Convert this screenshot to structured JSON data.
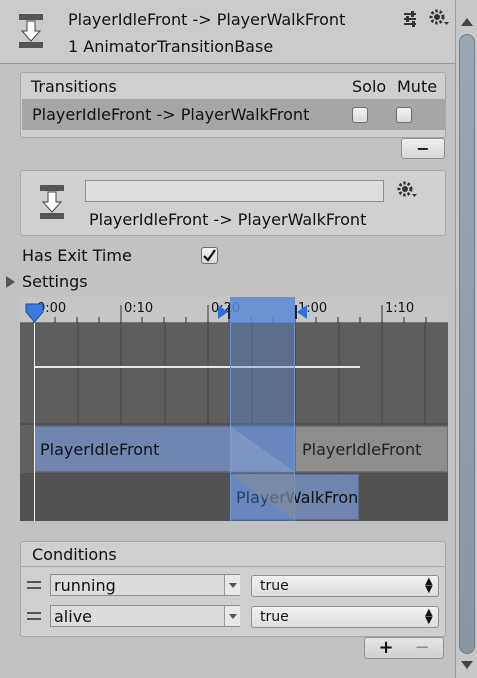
{
  "header": {
    "title": "PlayerIdleFront -> PlayerWalkFront",
    "subtitle": "1 AnimatorTransitionBase"
  },
  "transitions": {
    "heading": "Transitions",
    "solo_label": "Solo",
    "mute_label": "Mute",
    "rows": [
      {
        "label": "PlayerIdleFront -> PlayerWalkFront",
        "solo": false,
        "mute": false
      }
    ],
    "remove_label": "−"
  },
  "transition": {
    "name_value": "",
    "label": "PlayerIdleFront -> PlayerWalkFront"
  },
  "has_exit_time": {
    "label": "Has Exit Time",
    "checked": true
  },
  "settings": {
    "label": "Settings"
  },
  "timeline": {
    "ticks": [
      "0:00",
      "0:10",
      "0:20",
      "1:00",
      "1:10"
    ],
    "tracks": {
      "source_clip": "PlayerIdleFront",
      "source_clip_repeat": "PlayerIdleFront",
      "destination_clip": "PlayerWalkFront"
    }
  },
  "conditions": {
    "heading": "Conditions",
    "items": [
      {
        "parameter": "running",
        "value": "true"
      },
      {
        "parameter": "alive",
        "value": "true"
      }
    ],
    "add_label": "+",
    "remove_label": "−"
  },
  "colors": {
    "clip_blue": "#7086b0",
    "transition_blue": "#5a8ad6",
    "panel_bg": "#c2c2c2"
  }
}
